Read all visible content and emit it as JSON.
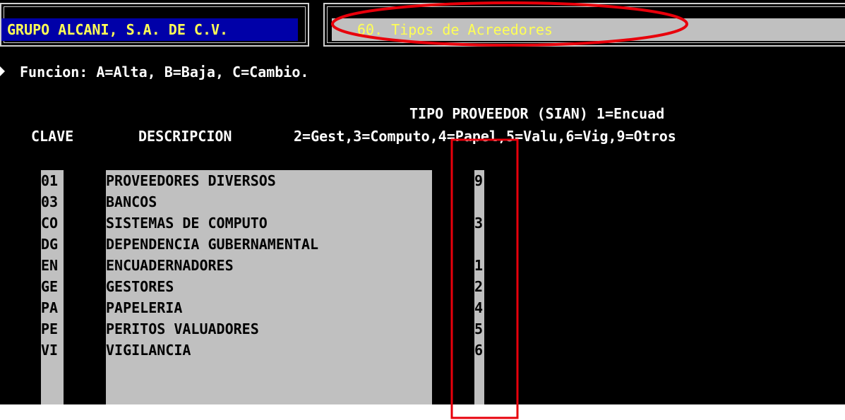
{
  "header": {
    "company": "GRUPO ALCANI, S.A. DE C.V.",
    "screen_title": "60. Tipos de Acreedores"
  },
  "functions_line": "Funcion: A=Alta, B=Baja, C=Cambio.",
  "columns": {
    "clave": "CLAVE",
    "descripcion": "DESCRIPCION",
    "tipo_line1": "TIPO PROVEEDOR (SIAN) 1=Encuad",
    "tipo_line2": "2=Gest,3=Computo,4=Papel,5=Valu,6=Vig,9=Otros"
  },
  "rows": [
    {
      "clave": "01",
      "descripcion": "PROVEEDORES DIVERSOS",
      "tipo": "9"
    },
    {
      "clave": "03",
      "descripcion": "BANCOS",
      "tipo": ""
    },
    {
      "clave": "CO",
      "descripcion": "SISTEMAS DE COMPUTO",
      "tipo": "3"
    },
    {
      "clave": "DG",
      "descripcion": "DEPENDENCIA GUBERNAMENTAL",
      "tipo": ""
    },
    {
      "clave": "EN",
      "descripcion": "ENCUADERNADORES",
      "tipo": "1"
    },
    {
      "clave": "GE",
      "descripcion": "GESTORES",
      "tipo": "2"
    },
    {
      "clave": "PA",
      "descripcion": "PAPELERIA",
      "tipo": "4"
    },
    {
      "clave": "PE",
      "descripcion": "PERITOS VALUADORES",
      "tipo": "5"
    },
    {
      "clave": "VI",
      "descripcion": "VIGILANCIA",
      "tipo": "6"
    }
  ],
  "colors": {
    "screen_bg": "#000000",
    "header_company_bg": "#0000a8",
    "header_text": "#ffff55",
    "field_bg": "#c0c0c0",
    "annotation": "#e8000b"
  }
}
